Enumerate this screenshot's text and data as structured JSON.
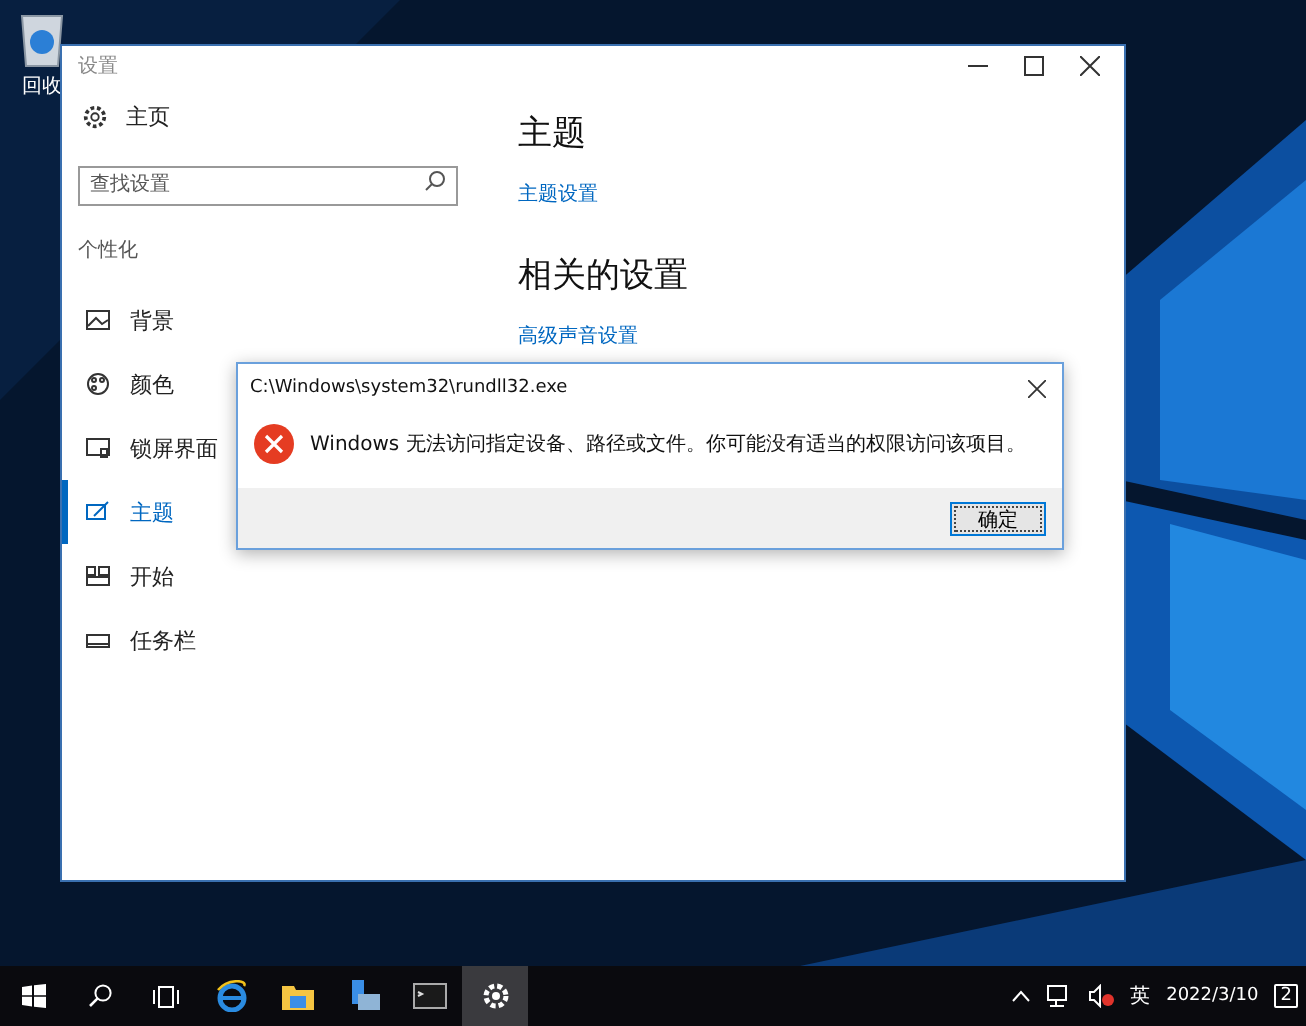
{
  "desktop": {
    "icons": [
      {
        "label": "回收"
      }
    ]
  },
  "settings_window": {
    "title": "设置",
    "home": "主页",
    "search": {
      "placeholder": "查找设置"
    },
    "section": "个性化",
    "nav": [
      {
        "label": "背景",
        "selected": false
      },
      {
        "label": "颜色",
        "selected": false
      },
      {
        "label": "锁屏界面",
        "selected": false
      },
      {
        "label": "主题",
        "selected": true
      },
      {
        "label": "开始",
        "selected": false
      },
      {
        "label": "任务栏",
        "selected": false
      }
    ],
    "heading": "主题",
    "link": "主题设置",
    "related_heading": "相关的设置",
    "related_link": "高级声音设置"
  },
  "dialog": {
    "title": "C:\\Windows\\system32\\rundll32.exe",
    "message": "Windows 无法访问指定设备、路径或文件。你可能没有适当的权限访问该项目。",
    "buttons": [
      "确定"
    ]
  },
  "taskbar": {
    "apps": [
      {
        "selected": false
      },
      {
        "selected": false
      },
      {
        "selected": false
      },
      {
        "selected": true
      }
    ],
    "ime": "英",
    "date": "2022/3/10",
    "notification_count": "2"
  }
}
